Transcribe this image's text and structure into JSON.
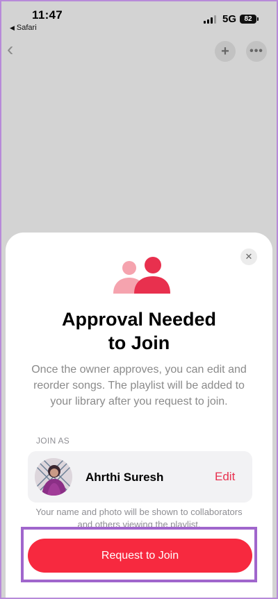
{
  "status_bar": {
    "time": "11:47",
    "back_app": "Safari",
    "network": "5G",
    "battery": "82"
  },
  "nav": {
    "back_icon": "‹",
    "plus_icon": "+",
    "more_icon": "•••"
  },
  "sheet": {
    "close_icon": "✕",
    "title_line1": "Approval Needed",
    "title_line2": "to Join",
    "description": "Once the owner approves, you can edit and reorder songs. The playlist will be added to your library after you request to join.",
    "join_as_label": "JOIN AS",
    "user_name": "Ahrthi Suresh",
    "edit_label": "Edit",
    "note": "Your name and photo will be shown to collaborators and others viewing the playlist.",
    "request_button": "Request to Join"
  },
  "colors": {
    "accent": "#f7293f",
    "icon_front": "#e8304e",
    "icon_back": "#f5a3ae",
    "highlight_border": "#a066cc"
  }
}
